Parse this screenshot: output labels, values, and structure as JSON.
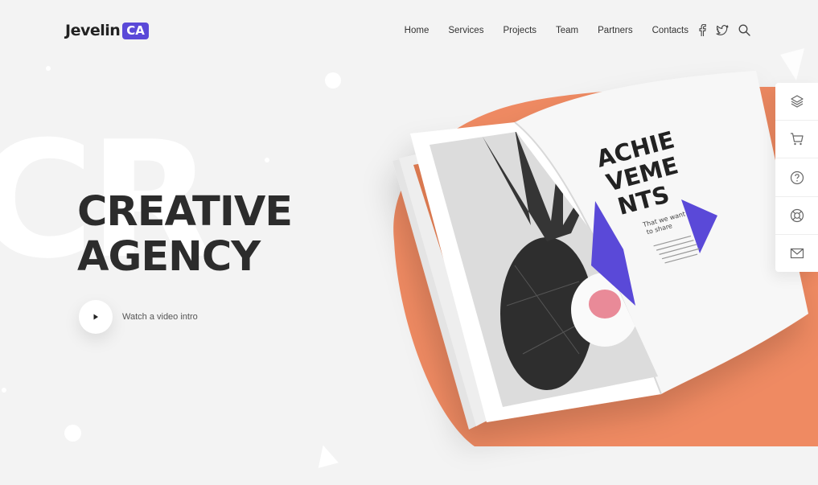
{
  "brand": {
    "name": "Jevelin",
    "badge": "CA"
  },
  "nav": {
    "links": [
      "Home",
      "Services",
      "Projects",
      "Team",
      "Partners",
      "Contacts"
    ],
    "icons": [
      "facebook-icon",
      "twitter-icon",
      "search-icon"
    ]
  },
  "hero": {
    "background_text": "CR",
    "title_line1": "CREATIVE",
    "title_line2": "AGENCY",
    "video_label": "Watch a video intro"
  },
  "magazine": {
    "heading_lines": [
      "ACHIE",
      "VEME",
      "NTS"
    ],
    "subheading_lines": [
      "That we want",
      "to share"
    ]
  },
  "sidebar": {
    "icons": [
      "layers-icon",
      "cart-icon",
      "help-icon",
      "lifebuoy-icon",
      "mail-icon"
    ]
  },
  "colors": {
    "accent": "#5a49d8",
    "orange": "#ef8a62",
    "text": "#2c2c2c",
    "background": "#f3f3f3"
  }
}
